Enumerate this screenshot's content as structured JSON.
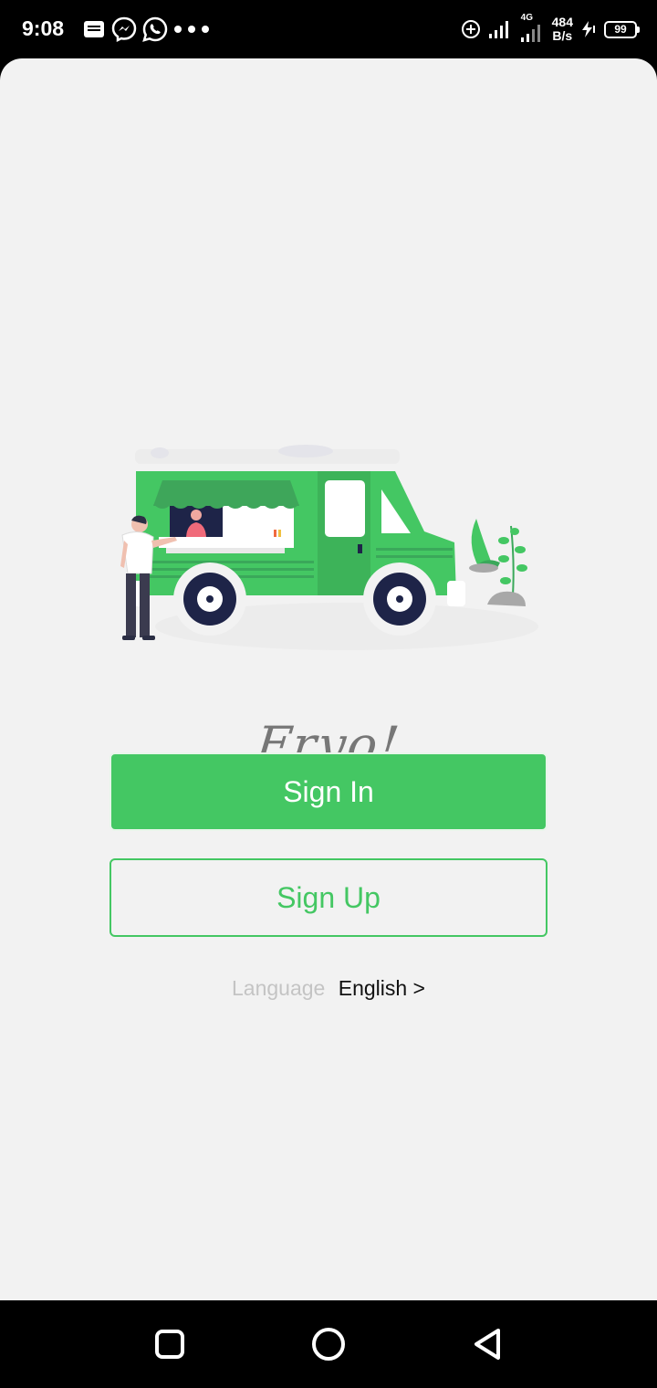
{
  "status_bar": {
    "time": "9:08",
    "network_type": "4G",
    "speed_value": "484",
    "speed_unit": "B/s",
    "battery": "99",
    "notification_icons": [
      "message-icon",
      "messenger-icon",
      "whatsapp-icon",
      "more-dots-icon"
    ],
    "system_icons": [
      "data-saver-icon",
      "signal-icon",
      "signal-4g-icon",
      "charging-icon",
      "battery-icon"
    ]
  },
  "app": {
    "name": "Fryo!",
    "illustration": "food-truck-illustration"
  },
  "actions": {
    "sign_in_label": "Sign In",
    "sign_up_label": "Sign Up"
  },
  "language": {
    "label": "Language",
    "value": "English >"
  },
  "navigation": {
    "buttons": [
      "recents-button",
      "home-button",
      "back-button"
    ]
  },
  "colors": {
    "accent": "#44c763",
    "background": "#f2f2f2",
    "brand_text": "#777777",
    "muted_text": "#c4c4c4"
  }
}
